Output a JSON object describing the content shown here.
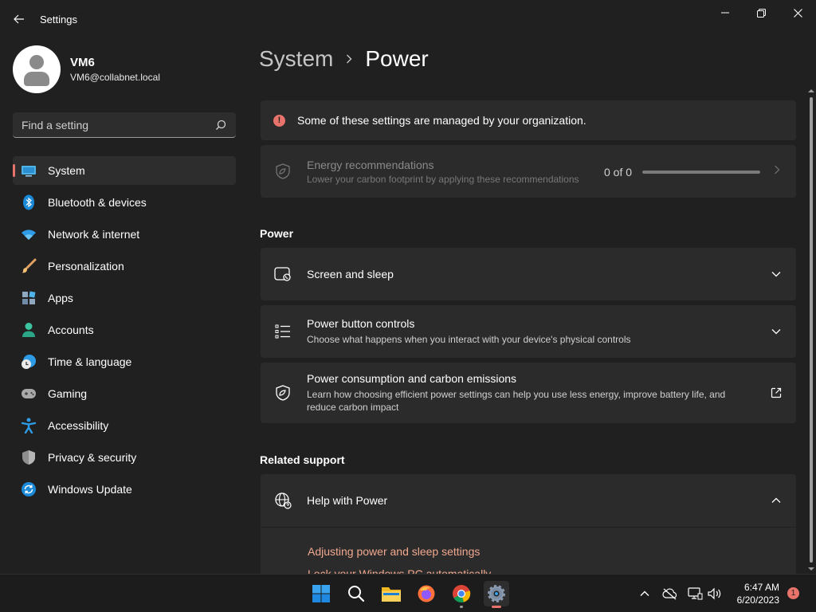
{
  "app": {
    "title": "Settings"
  },
  "user": {
    "name": "VM6",
    "email": "VM6@collabnet.local"
  },
  "search": {
    "placeholder": "Find a setting"
  },
  "nav": [
    {
      "label": "System",
      "icon": "system-icon"
    },
    {
      "label": "Bluetooth & devices",
      "icon": "bluetooth-icon"
    },
    {
      "label": "Network & internet",
      "icon": "wifi-icon"
    },
    {
      "label": "Personalization",
      "icon": "brush-icon"
    },
    {
      "label": "Apps",
      "icon": "apps-icon"
    },
    {
      "label": "Accounts",
      "icon": "accounts-icon"
    },
    {
      "label": "Time & language",
      "icon": "clock-globe-icon"
    },
    {
      "label": "Gaming",
      "icon": "gamepad-icon"
    },
    {
      "label": "Accessibility",
      "icon": "accessibility-icon"
    },
    {
      "label": "Privacy & security",
      "icon": "shield-icon"
    },
    {
      "label": "Windows Update",
      "icon": "update-icon"
    }
  ],
  "breadcrumb": {
    "parent": "System",
    "current": "Power"
  },
  "notice": {
    "text": "Some of these settings are managed by your organization."
  },
  "energy": {
    "title": "Energy recommendations",
    "subtitle": "Lower your carbon footprint by applying these recommendations",
    "count": "0 of 0",
    "progress": 0
  },
  "sections": {
    "power": "Power",
    "related": "Related support"
  },
  "power_rows": {
    "screen_sleep": {
      "title": "Screen and sleep"
    },
    "button_controls": {
      "title": "Power button controls",
      "subtitle": "Choose what happens when you interact with your device's physical controls"
    },
    "consumption": {
      "title": "Power consumption and carbon emissions",
      "subtitle": "Learn how choosing efficient power settings can help you use less energy, improve battery life, and reduce carbon impact"
    }
  },
  "help": {
    "title": "Help with Power",
    "links": [
      "Adjusting power and sleep settings",
      "Lock your Windows PC automatically"
    ]
  },
  "taskbar": {
    "time": "6:47 AM",
    "date": "6/20/2023",
    "notifications": "1"
  },
  "colors": {
    "accent": "#e8736b",
    "link": "#f1a88e",
    "background": "#202020",
    "card": "#2b2b2b"
  }
}
